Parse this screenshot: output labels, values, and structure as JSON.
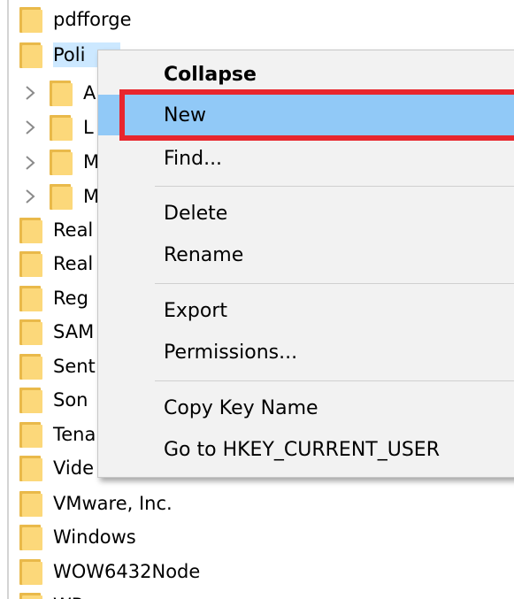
{
  "tree": {
    "items": [
      {
        "label": "pdfforge"
      },
      {
        "label": "Poli"
      },
      {
        "label": "A"
      },
      {
        "label": "L"
      },
      {
        "label": "M"
      },
      {
        "label": "M"
      },
      {
        "label": "Real"
      },
      {
        "label": "Real"
      },
      {
        "label": "Reg"
      },
      {
        "label": "SAM"
      },
      {
        "label": "Sent"
      },
      {
        "label": "Son"
      },
      {
        "label": "Tena"
      },
      {
        "label": "Vide"
      },
      {
        "label": "VMware, Inc."
      },
      {
        "label": "Windows"
      },
      {
        "label": "WOW6432Node"
      },
      {
        "label": "WP"
      }
    ]
  },
  "context_menu": {
    "collapse": "Collapse",
    "new": "New",
    "find": "Find...",
    "delete": "Delete",
    "rename": "Rename",
    "export": "Export",
    "permissions": "Permissions...",
    "copy_key_name": "Copy Key Name",
    "goto_hkcu": "Go to HKEY_CURRENT_USER"
  },
  "colors": {
    "menu_bg": "#f2f2f2",
    "hover_bg": "#91c9f7",
    "highlight_border": "#e8262d",
    "folder_back": "#e9b94a",
    "folder_front": "#fcd87a"
  }
}
